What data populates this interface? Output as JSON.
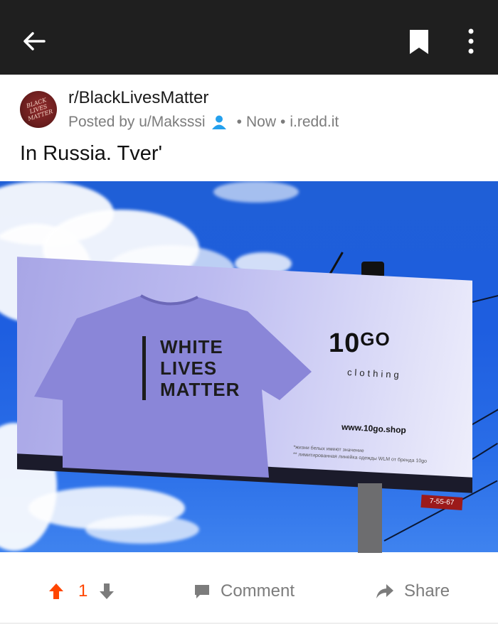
{
  "topbar": {
    "back_icon": "back-arrow-icon",
    "bookmark_icon": "bookmark-icon",
    "more_icon": "more-vertical-icon"
  },
  "post": {
    "subreddit": "r/BlackLivesMatter",
    "posted_by_prefix": "Posted by",
    "author": "u/Maksssi",
    "time": "Now",
    "domain": "i.redd.it",
    "title": "In Russia. Tver'"
  },
  "image_content": {
    "shirt_lines": [
      "WHITE",
      "LIVES",
      "MATTER"
    ],
    "brand": "10",
    "brand_sup": "GO",
    "brand_sub": "clothing",
    "website": "www.10go.shop",
    "fine_print_1": "*жизни белых имеют значение",
    "fine_print_2": "** лимитированная линейка одежды WLM от бренда 10go",
    "phone": "7-55-67"
  },
  "actions": {
    "vote_count": "1",
    "comment_label": "Comment",
    "share_label": "Share"
  },
  "colors": {
    "topbar": "#1f1f1f",
    "upvote": "#ff4500",
    "muted": "#7c7c7c",
    "avatar_person": "#24a0ed"
  }
}
